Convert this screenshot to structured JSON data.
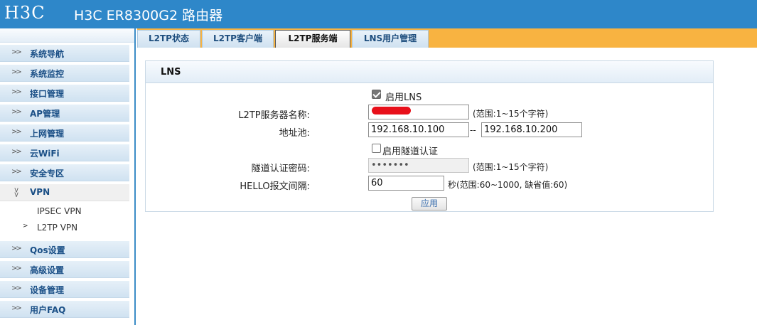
{
  "header": {
    "logo": "H3C",
    "title": "H3C ER8300G2 路由器"
  },
  "sidebar": {
    "items": [
      {
        "label": "系统导航"
      },
      {
        "label": "系统监控"
      },
      {
        "label": "接口管理"
      },
      {
        "label": "AP管理"
      },
      {
        "label": "上网管理"
      },
      {
        "label": "云WiFi"
      },
      {
        "label": "安全专区"
      },
      {
        "label": "VPN"
      },
      {
        "label": "Qos设置"
      },
      {
        "label": "高级设置"
      },
      {
        "label": "设备管理"
      },
      {
        "label": "用户FAQ"
      }
    ],
    "vpn_sub": [
      {
        "label": "IPSEC VPN"
      },
      {
        "label": "L2TP VPN"
      }
    ]
  },
  "tabs": [
    {
      "label": "L2TP状态"
    },
    {
      "label": "L2TP客户端"
    },
    {
      "label": "L2TP服务端"
    },
    {
      "label": "LNS用户管理"
    }
  ],
  "active_tab": "L2TP服务端",
  "panel": {
    "title": "LNS",
    "enable_lns": {
      "label": "启用LNS",
      "checked": true
    },
    "server_name": {
      "label": "L2TP服务器名称:",
      "value": "",
      "hint": "(范围:1~15个字符)"
    },
    "address_pool": {
      "label": "地址池:",
      "start": "192.168.10.100",
      "separator": "--",
      "end": "192.168.10.200"
    },
    "tunnel_auth": {
      "label": "启用隧道认证",
      "checked": false
    },
    "tunnel_password": {
      "label": "隧道认证密码:",
      "value": "•••••••",
      "hint": "(范围:1~15个字符)"
    },
    "hello_interval": {
      "label": "HELLO报文间隔:",
      "value": "60",
      "hint": "秒(范围:60~1000, 缺省值:60)"
    },
    "apply_label": "应用"
  },
  "colors": {
    "header_bg": "#2e87c9",
    "tab_bar": "#f8b341",
    "nav_text": "#1a4f86"
  }
}
